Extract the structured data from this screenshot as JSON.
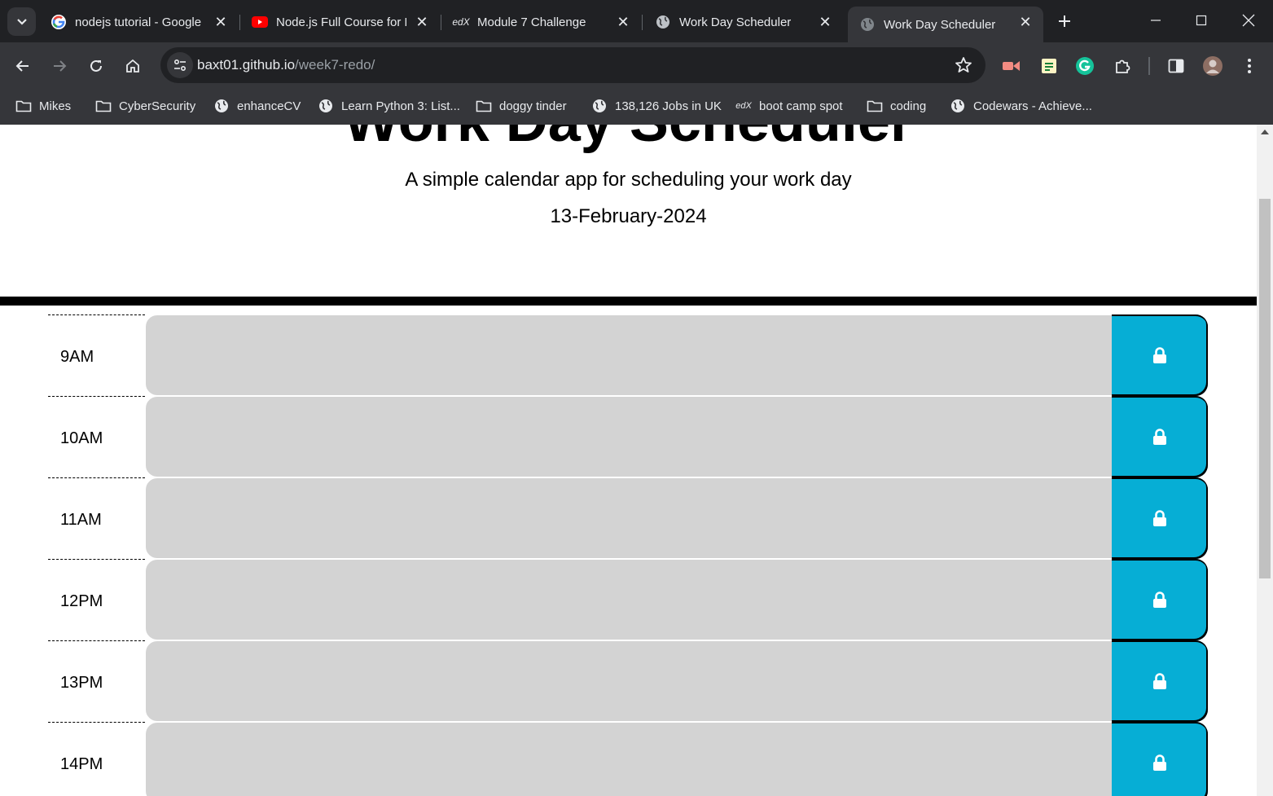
{
  "browser": {
    "tabs": [
      {
        "title": "nodejs tutorial - Google Search",
        "favicon": "google-icon"
      },
      {
        "title": "Node.js Full Course for Beginners",
        "favicon": "youtube-icon"
      },
      {
        "title": "Module 7 Challenge",
        "favicon": "edx-icon"
      },
      {
        "title": "Work Day Scheduler",
        "favicon": "globe-icon"
      },
      {
        "title": "Work Day Scheduler",
        "favicon": "globe-icon",
        "active": true
      }
    ],
    "url_host": "baxt01.github.io",
    "url_path": "/week7-redo/",
    "bookmarks": [
      {
        "label": "Mikes",
        "icon": "folder-icon"
      },
      {
        "label": "CyberSecurity",
        "icon": "folder-icon"
      },
      {
        "label": "enhanceCV",
        "icon": "globe-icon"
      },
      {
        "label": "Learn Python 3: List...",
        "icon": "globe-icon"
      },
      {
        "label": "doggy tinder",
        "icon": "folder-icon"
      },
      {
        "label": "138,126 Jobs in UK",
        "icon": "globe-icon"
      },
      {
        "label": "boot camp spot",
        "icon": "edx-icon"
      },
      {
        "label": "coding",
        "icon": "folder-icon"
      },
      {
        "label": "Codewars - Achieve...",
        "icon": "globe-icon"
      }
    ]
  },
  "page": {
    "title": "Work Day Scheduler",
    "lead": "A simple calendar app for scheduling your work day",
    "current_day": "13-February-2024",
    "time_blocks": [
      {
        "hour": "9AM",
        "text": ""
      },
      {
        "hour": "10AM",
        "text": ""
      },
      {
        "hour": "11AM",
        "text": ""
      },
      {
        "hour": "12PM",
        "text": ""
      },
      {
        "hour": "13PM",
        "text": ""
      },
      {
        "hour": "14PM",
        "text": ""
      }
    ],
    "save_icon": "lock-icon"
  },
  "colors": {
    "save_button": "#06aed5",
    "past_block": "#d3d3d3",
    "browser_dark": "#202124",
    "browser_toolbar": "#35363a"
  }
}
